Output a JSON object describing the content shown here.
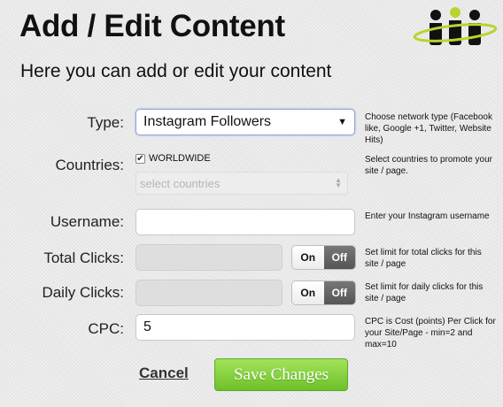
{
  "header": {
    "title": "Add / Edit Content",
    "subtitle": "Here you can add or edit your content"
  },
  "logo": {
    "icon": "people-ring-logo",
    "colors": [
      "#111111",
      "#b8d430"
    ]
  },
  "form": {
    "type": {
      "label": "Type:",
      "selected": "Instagram Followers",
      "help": "Choose network type (Facebook like, Google +1, Twitter, Website Hits)"
    },
    "countries": {
      "label": "Countries:",
      "worldwide_label": "WORLDWIDE",
      "worldwide_checked": true,
      "placeholder": "select countries",
      "help": "Select countries to promote your site / page."
    },
    "username": {
      "label": "Username:",
      "value": "",
      "help": "Enter your Instagram username"
    },
    "total_clicks": {
      "label": "Total Clicks:",
      "value": "",
      "on_label": "On",
      "off_label": "Off",
      "state": "off",
      "help": "Set limit for total clicks for this site / page"
    },
    "daily_clicks": {
      "label": "Daily Clicks:",
      "value": "",
      "on_label": "On",
      "off_label": "Off",
      "state": "off",
      "help": "Set limit for daily clicks for this site / page"
    },
    "cpc": {
      "label": "CPC:",
      "value": "5",
      "help": "CPC is Cost (points) Per Click for your Site/Page - min=2 and max=10"
    }
  },
  "actions": {
    "cancel_label": "Cancel",
    "save_label": "Save Changes",
    "save_color": "#7ccf34"
  }
}
